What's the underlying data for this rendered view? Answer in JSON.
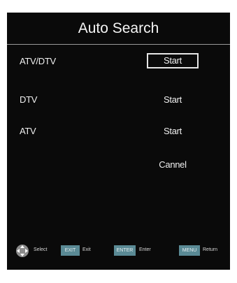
{
  "menu": {
    "title": "Auto Search",
    "rows": [
      {
        "label": "ATV/DTV",
        "action": "Start"
      },
      {
        "label": "DTV",
        "action": "Start"
      },
      {
        "label": "ATV",
        "action": "Start"
      },
      {
        "label": "",
        "action": "Cannel"
      }
    ]
  },
  "footer": {
    "select_label": "Select",
    "exit_key": "EXIT",
    "exit_label": "Exit",
    "enter_key": "ENTER",
    "enter_label": "Enter",
    "menu_key": "MENU",
    "menu_label": "Return"
  },
  "colors": {
    "background": "#0a0a0a",
    "key_bg": "#5a8a95",
    "dpad": "#8c8c8c"
  },
  "icons": [
    "navigation-dpad-icon"
  ]
}
